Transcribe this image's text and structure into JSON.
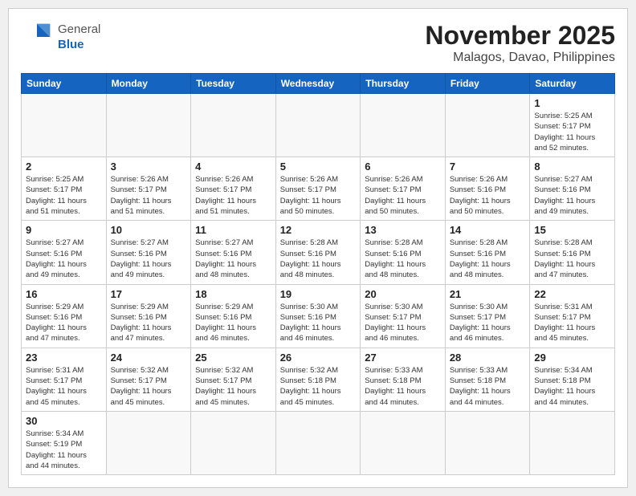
{
  "header": {
    "logo_general": "General",
    "logo_blue": "Blue",
    "month_title": "November 2025",
    "location": "Malagos, Davao, Philippines"
  },
  "weekdays": [
    "Sunday",
    "Monday",
    "Tuesday",
    "Wednesday",
    "Thursday",
    "Friday",
    "Saturday"
  ],
  "weeks": [
    [
      {
        "day": "",
        "info": ""
      },
      {
        "day": "",
        "info": ""
      },
      {
        "day": "",
        "info": ""
      },
      {
        "day": "",
        "info": ""
      },
      {
        "day": "",
        "info": ""
      },
      {
        "day": "",
        "info": ""
      },
      {
        "day": "1",
        "info": "Sunrise: 5:25 AM\nSunset: 5:17 PM\nDaylight: 11 hours\nand 52 minutes."
      }
    ],
    [
      {
        "day": "2",
        "info": "Sunrise: 5:25 AM\nSunset: 5:17 PM\nDaylight: 11 hours\nand 51 minutes."
      },
      {
        "day": "3",
        "info": "Sunrise: 5:26 AM\nSunset: 5:17 PM\nDaylight: 11 hours\nand 51 minutes."
      },
      {
        "day": "4",
        "info": "Sunrise: 5:26 AM\nSunset: 5:17 PM\nDaylight: 11 hours\nand 51 minutes."
      },
      {
        "day": "5",
        "info": "Sunrise: 5:26 AM\nSunset: 5:17 PM\nDaylight: 11 hours\nand 50 minutes."
      },
      {
        "day": "6",
        "info": "Sunrise: 5:26 AM\nSunset: 5:17 PM\nDaylight: 11 hours\nand 50 minutes."
      },
      {
        "day": "7",
        "info": "Sunrise: 5:26 AM\nSunset: 5:16 PM\nDaylight: 11 hours\nand 50 minutes."
      },
      {
        "day": "8",
        "info": "Sunrise: 5:27 AM\nSunset: 5:16 PM\nDaylight: 11 hours\nand 49 minutes."
      }
    ],
    [
      {
        "day": "9",
        "info": "Sunrise: 5:27 AM\nSunset: 5:16 PM\nDaylight: 11 hours\nand 49 minutes."
      },
      {
        "day": "10",
        "info": "Sunrise: 5:27 AM\nSunset: 5:16 PM\nDaylight: 11 hours\nand 49 minutes."
      },
      {
        "day": "11",
        "info": "Sunrise: 5:27 AM\nSunset: 5:16 PM\nDaylight: 11 hours\nand 48 minutes."
      },
      {
        "day": "12",
        "info": "Sunrise: 5:28 AM\nSunset: 5:16 PM\nDaylight: 11 hours\nand 48 minutes."
      },
      {
        "day": "13",
        "info": "Sunrise: 5:28 AM\nSunset: 5:16 PM\nDaylight: 11 hours\nand 48 minutes."
      },
      {
        "day": "14",
        "info": "Sunrise: 5:28 AM\nSunset: 5:16 PM\nDaylight: 11 hours\nand 48 minutes."
      },
      {
        "day": "15",
        "info": "Sunrise: 5:28 AM\nSunset: 5:16 PM\nDaylight: 11 hours\nand 47 minutes."
      }
    ],
    [
      {
        "day": "16",
        "info": "Sunrise: 5:29 AM\nSunset: 5:16 PM\nDaylight: 11 hours\nand 47 minutes."
      },
      {
        "day": "17",
        "info": "Sunrise: 5:29 AM\nSunset: 5:16 PM\nDaylight: 11 hours\nand 47 minutes."
      },
      {
        "day": "18",
        "info": "Sunrise: 5:29 AM\nSunset: 5:16 PM\nDaylight: 11 hours\nand 46 minutes."
      },
      {
        "day": "19",
        "info": "Sunrise: 5:30 AM\nSunset: 5:16 PM\nDaylight: 11 hours\nand 46 minutes."
      },
      {
        "day": "20",
        "info": "Sunrise: 5:30 AM\nSunset: 5:17 PM\nDaylight: 11 hours\nand 46 minutes."
      },
      {
        "day": "21",
        "info": "Sunrise: 5:30 AM\nSunset: 5:17 PM\nDaylight: 11 hours\nand 46 minutes."
      },
      {
        "day": "22",
        "info": "Sunrise: 5:31 AM\nSunset: 5:17 PM\nDaylight: 11 hours\nand 45 minutes."
      }
    ],
    [
      {
        "day": "23",
        "info": "Sunrise: 5:31 AM\nSunset: 5:17 PM\nDaylight: 11 hours\nand 45 minutes."
      },
      {
        "day": "24",
        "info": "Sunrise: 5:32 AM\nSunset: 5:17 PM\nDaylight: 11 hours\nand 45 minutes."
      },
      {
        "day": "25",
        "info": "Sunrise: 5:32 AM\nSunset: 5:17 PM\nDaylight: 11 hours\nand 45 minutes."
      },
      {
        "day": "26",
        "info": "Sunrise: 5:32 AM\nSunset: 5:18 PM\nDaylight: 11 hours\nand 45 minutes."
      },
      {
        "day": "27",
        "info": "Sunrise: 5:33 AM\nSunset: 5:18 PM\nDaylight: 11 hours\nand 44 minutes."
      },
      {
        "day": "28",
        "info": "Sunrise: 5:33 AM\nSunset: 5:18 PM\nDaylight: 11 hours\nand 44 minutes."
      },
      {
        "day": "29",
        "info": "Sunrise: 5:34 AM\nSunset: 5:18 PM\nDaylight: 11 hours\nand 44 minutes."
      }
    ],
    [
      {
        "day": "30",
        "info": "Sunrise: 5:34 AM\nSunset: 5:19 PM\nDaylight: 11 hours\nand 44 minutes."
      },
      {
        "day": "",
        "info": ""
      },
      {
        "day": "",
        "info": ""
      },
      {
        "day": "",
        "info": ""
      },
      {
        "day": "",
        "info": ""
      },
      {
        "day": "",
        "info": ""
      },
      {
        "day": "",
        "info": ""
      }
    ]
  ]
}
